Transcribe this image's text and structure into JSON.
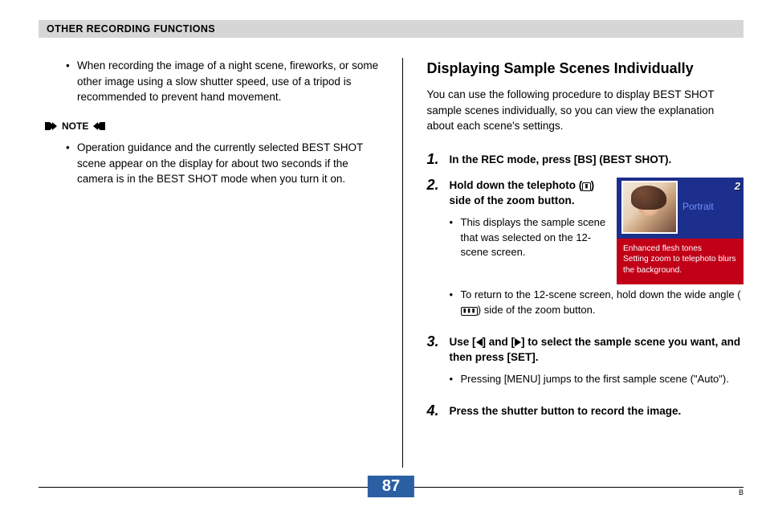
{
  "header": {
    "title": "OTHER RECORDING FUNCTIONS"
  },
  "left": {
    "bullet1": "When recording the image of a night scene, fireworks, or some other image using a slow shutter speed, use of a tripod is recommended to prevent hand movement.",
    "note_label": "NOTE",
    "note_bullet": "Operation guidance and the currently selected BEST SHOT scene appear on the display for about two seconds if the camera is in the BEST SHOT mode when you turn it on."
  },
  "right": {
    "heading": "Displaying Sample Scenes Individually",
    "intro": "You can use the following procedure to display BEST SHOT sample scenes individually, so you can view the explanation about each scene's settings.",
    "step1": {
      "num": "1.",
      "title": "In the REC mode, press [BS] (BEST SHOT)."
    },
    "step2": {
      "num": "2.",
      "title_a": "Hold down the telephoto (",
      "title_b": ") side of the zoom button.",
      "tele_icon_text": "◘",
      "sub1": "This displays the sample scene that was selected on the 12-scene screen.",
      "sub2_a": "To return to the 12-scene screen, hold down the wide angle (",
      "sub2_b": ") side of the zoom button.",
      "wide_icon_text": "◘◘◘"
    },
    "step3": {
      "num": "3.",
      "title_a": "Use [",
      "title_b": "] and [",
      "title_c": "] to select the sample scene you want, and then press [SET].",
      "sub1": "Pressing [MENU] jumps to the first sample scene (\"Auto\")."
    },
    "step4": {
      "num": "4.",
      "title": "Press the shutter button to record the image."
    },
    "scene_card": {
      "badge": "2",
      "label": "Portrait",
      "desc_l1": "Enhanced flesh tones",
      "desc_l2": "Setting zoom to telephoto blurs the background."
    }
  },
  "footer": {
    "page": "87",
    "corner": "B"
  }
}
